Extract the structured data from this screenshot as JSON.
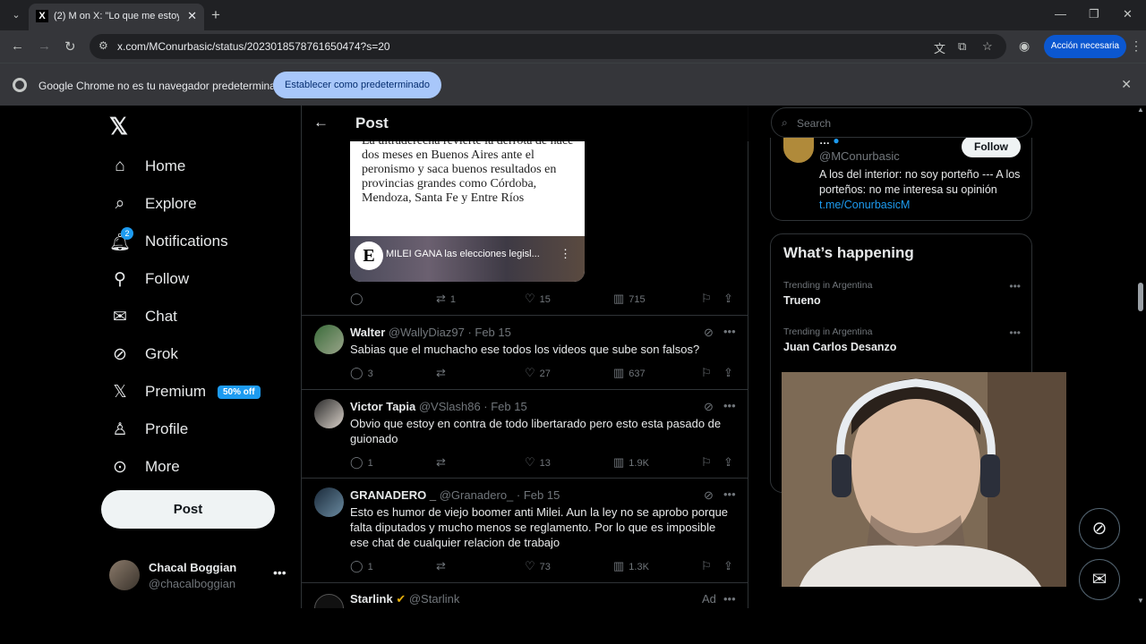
{
  "browser": {
    "tab_title": "(2) M on X: \"Lo que me estoy di",
    "tab_favicon": "X",
    "url": "x.com/MConurbasic/status/2023018578761650474?s=20",
    "action_button": "Acción necesaria",
    "infobar_message": "Google Chrome no es tu navegador predeterminado",
    "infobar_button": "Establecer como predeterminado"
  },
  "sidebar": {
    "logo": "𝕏",
    "items": [
      {
        "label": "Home",
        "icon": "home-icon"
      },
      {
        "label": "Explore",
        "icon": "search-icon"
      },
      {
        "label": "Notifications",
        "icon": "bell-icon",
        "badge": "2"
      },
      {
        "label": "Follow",
        "icon": "follow-icon"
      },
      {
        "label": "Chat",
        "icon": "mail-icon"
      },
      {
        "label": "Grok",
        "icon": "grok-icon"
      },
      {
        "label": "Premium",
        "icon": "x-icon",
        "badge": "50% off"
      },
      {
        "label": "Profile",
        "icon": "person-icon"
      },
      {
        "label": "More",
        "icon": "more-circle-icon"
      }
    ],
    "post_button": "Post",
    "account": {
      "name": "Chacal Boggian",
      "handle": "@chacalboggian"
    }
  },
  "main": {
    "header_title": "Post",
    "article_text": "La ultraderecha revierte la derrota de hace dos meses en Buenos Aires ante el peronismo y saca buenos resultados en provincias grandes como Córdoba, Mendoza, Santa Fe y Entre Ríos",
    "video_title": "MILEI GANA las elecciones legisl...",
    "video_logo": "E",
    "main_actions": {
      "replies": "",
      "reposts": "1",
      "likes": "15",
      "views": "715"
    },
    "replies": [
      {
        "name": "Walter",
        "handle": "@WallyDiaz97 · Feb 15",
        "text": "Sabias que el muchacho ese todos los videos que sube son falsos?",
        "replies": "3",
        "reposts": "",
        "likes": "27",
        "views": "637"
      },
      {
        "name": "Victor Tapia",
        "handle": "@VSlash86 · Feb 15",
        "text": "Obvio que estoy en contra de todo libertarado pero esto esta pasado de guionado",
        "replies": "1",
        "reposts": "",
        "likes": "13",
        "views": "1.9K"
      },
      {
        "name": "GRANADERO _",
        "handle": "@Granadero_ · Feb 15",
        "text": "Esto es humor de viejo boomer anti Milei. Aun la ley no se aprobo porque falta diputados y mucho menos se reglamento. Por lo que es imposible ese chat de cualquier relacion de trabajo",
        "replies": "1",
        "reposts": "",
        "likes": "73",
        "views": "1.3K"
      }
    ],
    "ad": {
      "name": "Starlink",
      "handle": "@Starlink",
      "label": "Ad"
    }
  },
  "right": {
    "search_placeholder": "Search",
    "profile": {
      "handle": "@MConurbasic",
      "follow_label": "Follow",
      "bio": "A los del interior: no soy porteño --- A los porteños: no me interesa su opinión ",
      "bio_link": "t.me/ConurbasicM"
    },
    "happening": {
      "title": "What’s happening",
      "trends": [
        {
          "context": "Trending in Argentina",
          "title": "Trueno"
        },
        {
          "context": "Trending in Argentina",
          "title": "Juan Carlos Desanzo"
        }
      ]
    }
  }
}
